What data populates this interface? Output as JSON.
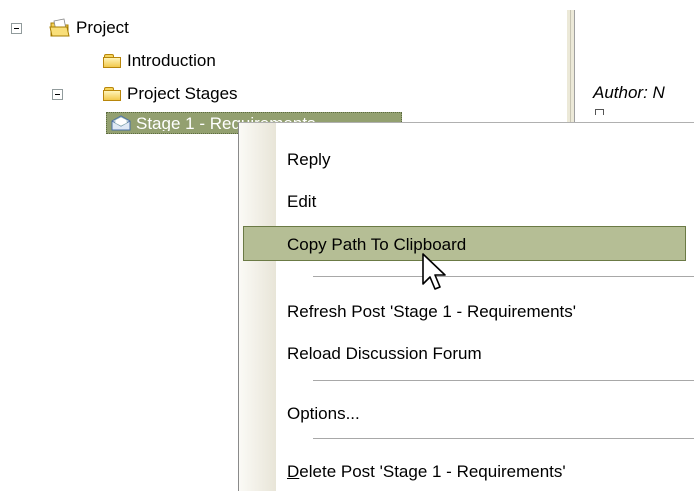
{
  "tree": {
    "root": {
      "label": "Project"
    },
    "introduction": {
      "label": "Introduction"
    },
    "stages": {
      "label": "Project Stages"
    },
    "selected": {
      "label": "Stage 1 - Requirements"
    }
  },
  "right_pane": {
    "author_label": "Author: N"
  },
  "context_menu": {
    "reply": "Reply",
    "edit": "Edit",
    "copy_path": "Copy Path To Clipboard",
    "refresh": "Refresh Post 'Stage 1 - Requirements'",
    "reload": "Reload Discussion Forum",
    "options": "Options...",
    "delete_mnemonic": "D",
    "delete_rest": "elete Post 'Stage 1 - Requirements'"
  },
  "colors": {
    "selection": "#93a070",
    "menu_highlight": "#b5be95",
    "menu_gutter": "#e8e5d8"
  },
  "icons": {
    "project": "project-folder-icon",
    "folder": "folder-icon",
    "post": "open-envelope-icon",
    "cursor": "mouse-pointer-icon"
  }
}
